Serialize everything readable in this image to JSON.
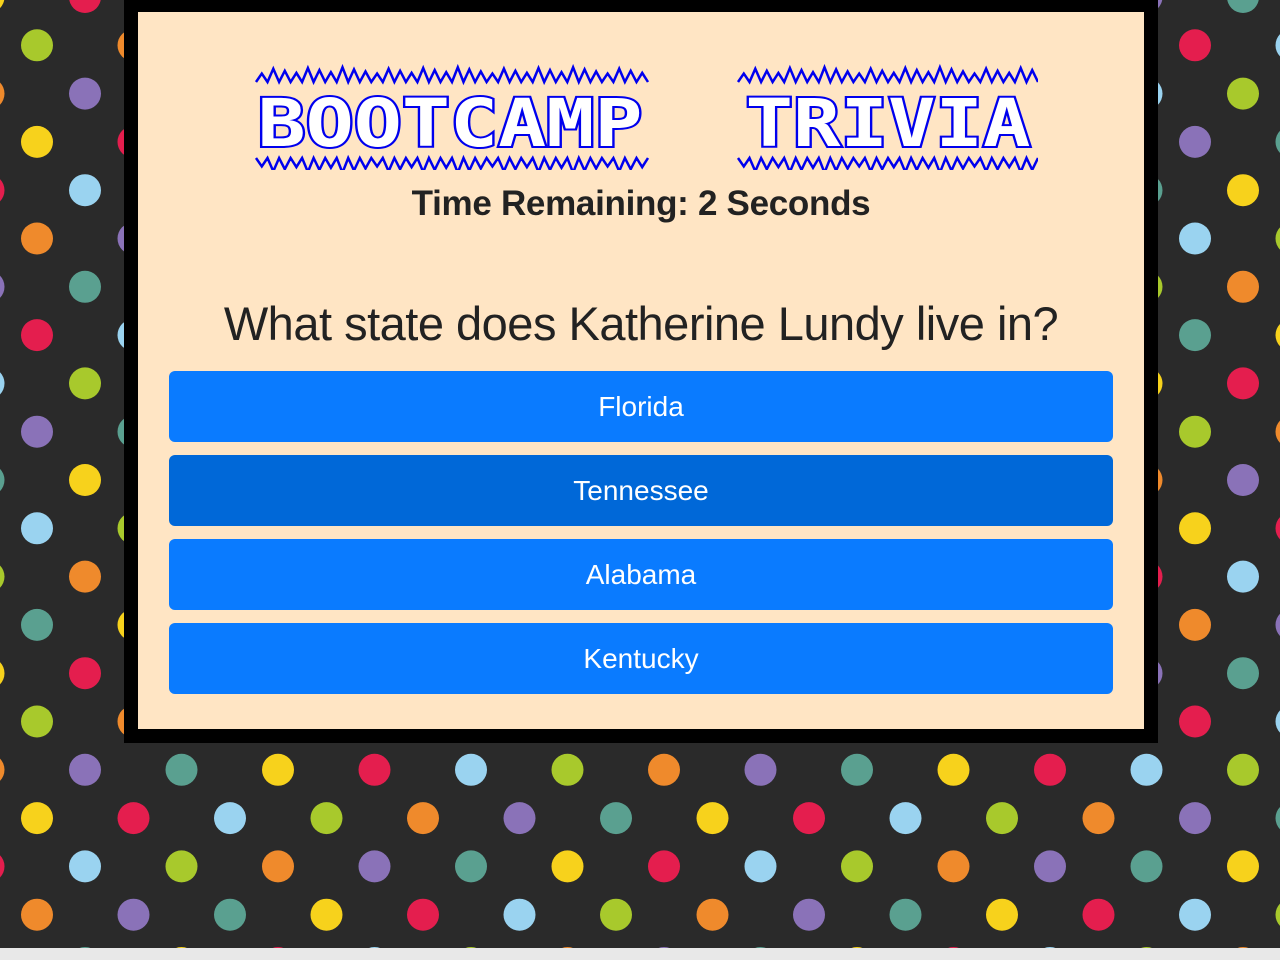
{
  "header": {
    "logo_word_1": "BOOTCAMP",
    "logo_word_2": "TRIVIA"
  },
  "timer": {
    "text": "Time Remaining: 2 Seconds",
    "seconds_remaining": 2
  },
  "question": {
    "text": "What state does Katherine Lundy live in?"
  },
  "answers": [
    {
      "label": "Florida"
    },
    {
      "label": "Tennessee",
      "hovered": true
    },
    {
      "label": "Alabama"
    },
    {
      "label": "Kentucky"
    }
  ],
  "colors": {
    "background": "#2a2a2a",
    "card": "#ffe5c4",
    "button": "#0a7bff",
    "button_hover": "#0068d8",
    "logo": "#0000ee",
    "dot_palette": [
      "#e41e4e",
      "#ef8a2c",
      "#f7d21c",
      "#a8c92c",
      "#5aa090",
      "#9ad3f0",
      "#8a72b8"
    ]
  }
}
